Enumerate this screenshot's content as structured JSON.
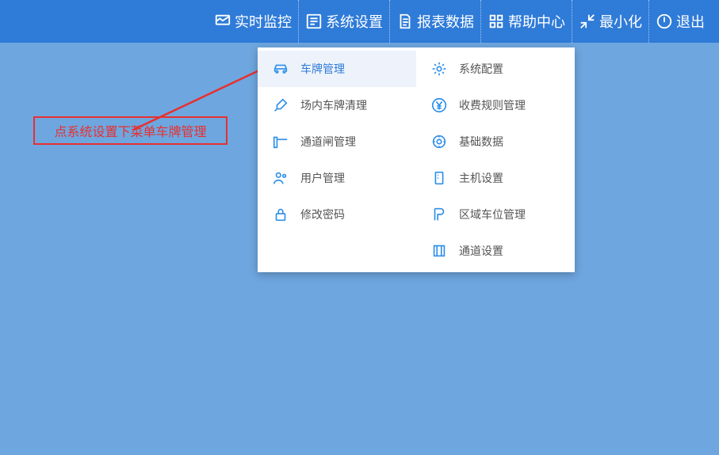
{
  "topnav": {
    "monitor": "实时监控",
    "settings": "系统设置",
    "reports": "报表数据",
    "help": "帮助中心",
    "minimize": "最小化",
    "exit": "退出"
  },
  "annotation": {
    "text": "点系统设置下菜单车牌管理"
  },
  "dropdown": {
    "left": [
      {
        "label": "车牌管理"
      },
      {
        "label": "场内车牌清理"
      },
      {
        "label": "通道闸管理"
      },
      {
        "label": "用户管理"
      },
      {
        "label": "修改密码"
      }
    ],
    "right": [
      {
        "label": "系统配置"
      },
      {
        "label": "收费规则管理"
      },
      {
        "label": "基础数据"
      },
      {
        "label": "主机设置"
      },
      {
        "label": "区域车位管理"
      },
      {
        "label": "通道设置"
      }
    ]
  }
}
